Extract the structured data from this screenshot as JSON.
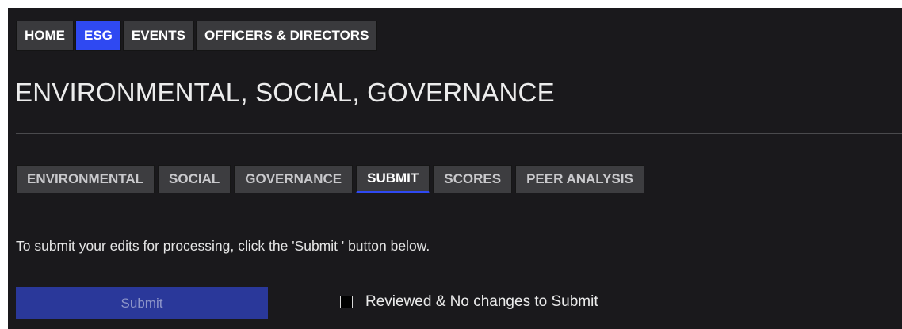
{
  "top_nav": {
    "tabs": [
      {
        "label": "HOME",
        "active": false
      },
      {
        "label": "ESG",
        "active": true
      },
      {
        "label": "EVENTS",
        "active": false
      },
      {
        "label": "OFFICERS & DIRECTORS",
        "active": false
      }
    ]
  },
  "page": {
    "title": "ENVIRONMENTAL, SOCIAL, GOVERNANCE"
  },
  "sub_nav": {
    "tabs": [
      {
        "label": "ENVIRONMENTAL",
        "active": false
      },
      {
        "label": "SOCIAL",
        "active": false
      },
      {
        "label": "GOVERNANCE",
        "active": false
      },
      {
        "label": "SUBMIT",
        "active": true
      },
      {
        "label": "SCORES",
        "active": false
      },
      {
        "label": "PEER ANALYSIS",
        "active": false
      }
    ]
  },
  "submit_section": {
    "instructions": "To submit your edits for processing, click the 'Submit ' button below.",
    "submit_label": "Submit",
    "checkbox_label": "Reviewed & No changes to Submit",
    "checkbox_checked": false
  },
  "colors": {
    "background": "#1a191c",
    "accent": "#2f49f2",
    "tab_background": "#3a3a3d",
    "submit_button": "#2a389a"
  }
}
